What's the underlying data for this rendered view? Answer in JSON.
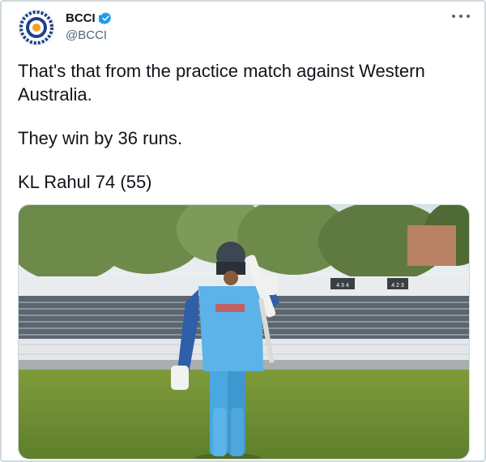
{
  "account": {
    "name": "BCCI",
    "handle": "@BCCI",
    "verified": true
  },
  "tweet": {
    "line1": "That's that from the practice match against Western",
    "line2": "Australia.",
    "line3": "They win by 36 runs.",
    "line4": "KL Rahul 74 (55)"
  },
  "media": {
    "scoreboard_left": "4 3 4",
    "scoreboard_right": "4 2 3"
  },
  "colors": {
    "verified": "#1d9bf0",
    "text": "#0f1419",
    "muted": "#536471"
  }
}
